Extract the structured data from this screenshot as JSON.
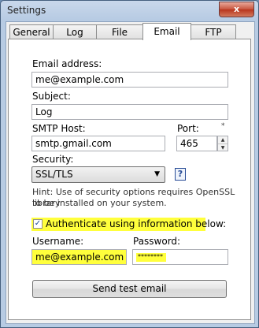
{
  "window": {
    "title": "Settings",
    "close_label": "x"
  },
  "tabs": [
    {
      "label": "General"
    },
    {
      "label": "Log"
    },
    {
      "label": "File"
    },
    {
      "label": "Email",
      "active": true
    },
    {
      "label": "FTP"
    }
  ],
  "form": {
    "email_label": "Email address:",
    "email_value": "me@example.com",
    "subject_label": "Subject:",
    "subject_value": "Log",
    "smtp_label": "SMTP Host:",
    "smtp_value": "smtp.gmail.com",
    "port_label": "Port:",
    "port_value": "465",
    "port_marker": "*",
    "security_label": "Security:",
    "security_value": "SSL/TLS",
    "help_label": "?",
    "hint_line1": "Hint: Use of security options requires OpenSSL library",
    "hint_line2": "to be installed on your system.",
    "auth_label": "Authenticate using information below:",
    "auth_checked": true,
    "username_label": "Username:",
    "username_value": "me@example.com",
    "password_label": "Password:",
    "password_value": "********",
    "send_button": "Send test email"
  },
  "colors": {
    "highlight": "#ffff3c"
  }
}
